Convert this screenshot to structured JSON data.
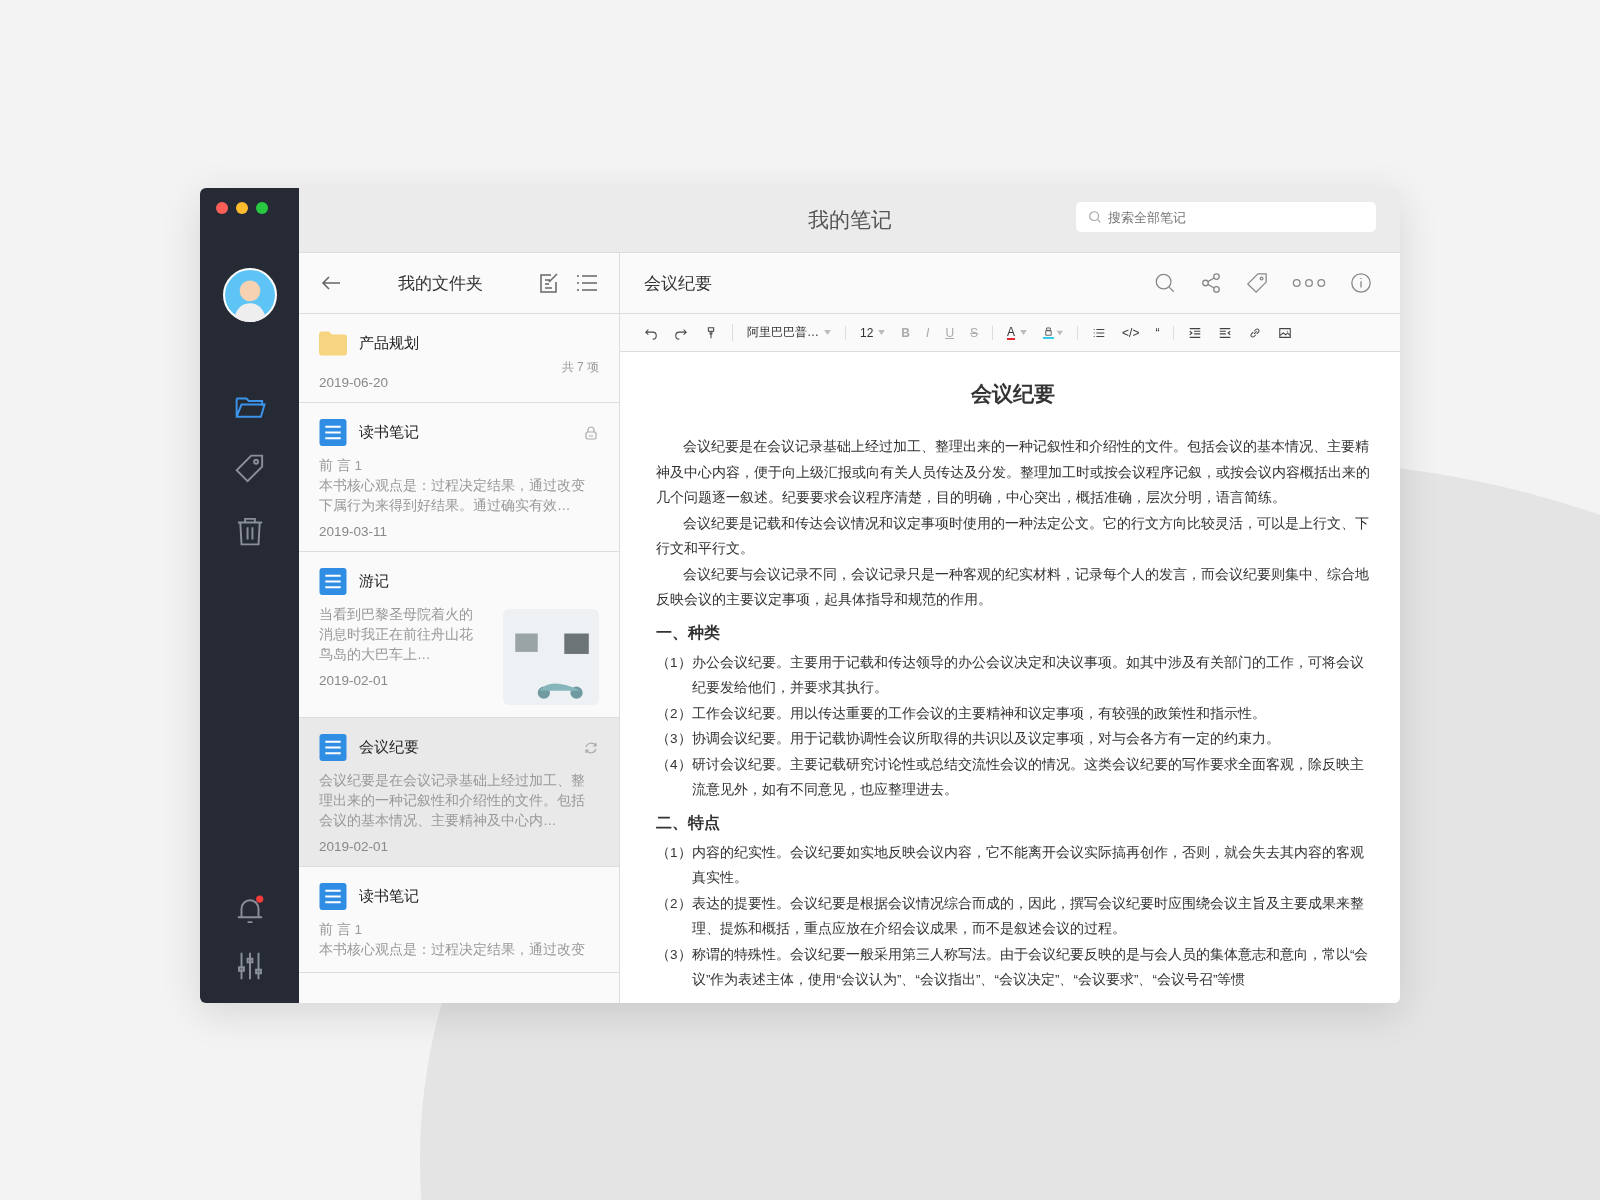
{
  "window": {
    "title": "我的笔记"
  },
  "search": {
    "placeholder": "搜索全部笔记"
  },
  "sidebar": {
    "items": [
      {
        "selected": true
      },
      {
        "selected": false
      },
      {
        "selected": false
      }
    ],
    "notification_badge": true
  },
  "folder_pane": {
    "title": "我的文件夹",
    "notes": [
      {
        "kind": "folder",
        "title": "产品规划",
        "date": "2019-06-20",
        "count": "共 7 项",
        "selected": false
      },
      {
        "kind": "note",
        "title": "读书笔记",
        "subtitle": "前 言 1",
        "preview": "本书核心观点是：过程决定结果，通过改变下属行为来得到好结果。通过确实有效…",
        "date": "2019-03-11",
        "locked": true,
        "syncing": false,
        "photo": false,
        "selected": false
      },
      {
        "kind": "note",
        "title": "游记",
        "preview": "当看到巴黎圣母院着火的消息时我正在前往舟山花鸟岛的大巴车上…",
        "date": "2019-02-01",
        "locked": false,
        "syncing": false,
        "photo": true,
        "selected": false
      },
      {
        "kind": "note",
        "title": "会议纪要",
        "preview": "会议纪要是在会议记录基础上经过加工、整理出来的一种记叙性和介绍性的文件。包括会议的基本情况、主要精神及中心内…",
        "date": "2019-02-01",
        "locked": false,
        "syncing": true,
        "photo": false,
        "selected": true
      },
      {
        "kind": "note",
        "title": "读书笔记",
        "subtitle": "前 言 1",
        "preview": "本书核心观点是：过程决定结果，通过改变",
        "locked": false,
        "syncing": false,
        "photo": false,
        "selected": false
      }
    ]
  },
  "editor": {
    "title": "会议纪要",
    "toolbar": {
      "font": "阿里巴巴普…",
      "size": "12",
      "styles": [
        {
          "label": "B",
          "disabled": true
        },
        {
          "label": "I",
          "disabled": true
        },
        {
          "label": "U",
          "disabled": true
        },
        {
          "label": "S",
          "disabled": true
        }
      ],
      "text_color": "A",
      "code": "</>",
      "quote": "“"
    },
    "doc_title": "会议纪要",
    "blocks": [
      {
        "kind": "para",
        "text": "会议纪要是在会议记录基础上经过加工、整理出来的一种记叙性和介绍性的文件。包括会议的基本情况、主要精神及中心内容，便于向上级汇报或向有关人员传达及分发。整理加工时或按会议程序记叙，或按会议内容概括出来的几个问题逐一叙述。纪要要求会议程序清楚，目的明确，中心突出，概括准确，层次分明，语言简练。"
      },
      {
        "kind": "para",
        "text": "会议纪要是记载和传达会议情况和议定事项时使用的一种法定公文。它的行文方向比较灵活，可以是上行文、下行文和平行文。"
      },
      {
        "kind": "para",
        "text": "会议纪要与会议记录不同，会议记录只是一种客观的纪实材料，记录每个人的发言，而会议纪要则集中、综合地反映会议的主要议定事项，起具体指导和规范的作用。"
      },
      {
        "kind": "heading",
        "text": "一、种类"
      },
      {
        "kind": "item",
        "marker": "（1）",
        "text": "办公会议纪要。主要用于记载和传达领导的办公会议决定和决议事项。如其中涉及有关部门的工作，可将会议纪要发给他们，并要求其执行。"
      },
      {
        "kind": "item",
        "marker": "（2）",
        "text": "工作会议纪要。用以传达重要的工作会议的主要精神和议定事项，有较强的政策性和指示性。"
      },
      {
        "kind": "item",
        "marker": "（3）",
        "text": "协调会议纪要。用于记载协调性会议所取得的共识以及议定事项，对与会各方有一定的约束力。"
      },
      {
        "kind": "item",
        "marker": "（4）",
        "text": "研讨会议纪要。主要记载研究讨论性或总结交流性会议的情况。这类会议纪要的写作要求全面客观，除反映主流意见外，如有不同意见，也应整理进去。"
      },
      {
        "kind": "heading",
        "text": "二、特点"
      },
      {
        "kind": "item",
        "marker": "（1）",
        "text": "内容的纪实性。会议纪要如实地反映会议内容，它不能离开会议实际搞再创作，否则，就会失去其内容的客观真实性。"
      },
      {
        "kind": "item",
        "marker": "（2）",
        "text": "表达的提要性。会议纪要是根据会议情况综合而成的，因此，撰写会议纪要时应围绕会议主旨及主要成果来整理、提炼和概括，重点应放在介绍会议成果，而不是叙述会议的过程。"
      },
      {
        "kind": "item",
        "marker": "（3）",
        "text": "称谓的特殊性。会议纪要一般采用第三人称写法。由于会议纪要反映的是与会人员的集体意志和意向，常以“会议”作为表述主体，使用“会议认为”、“会议指出”、“会议决定”、“会议要求”、“会议号召”等惯"
      }
    ]
  }
}
